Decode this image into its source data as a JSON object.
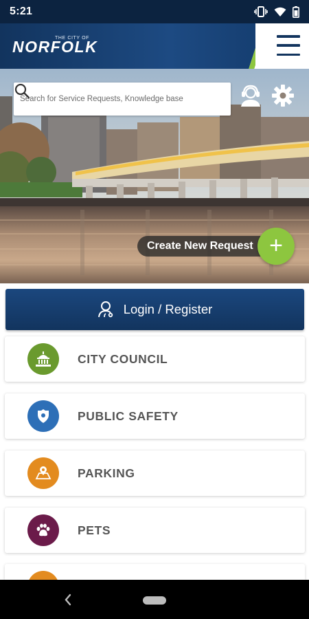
{
  "status_bar": {
    "time": "5:21",
    "icons": [
      "vibrate-icon",
      "wifi-icon",
      "battery-icon"
    ]
  },
  "header": {
    "logo_small": "THE CITY OF",
    "logo_main": "NORFOLK",
    "menu_icon": "hamburger-menu-icon",
    "colors": {
      "navy": "#12345e",
      "accent_green": "#8dc63f"
    }
  },
  "hero": {
    "search_placeholder": "Search for Service Requests, Knowledge base",
    "search_icon": "search-icon",
    "agent_icon": "agent-headset-icon",
    "settings_icon": "gear-icon",
    "create_request_label": "Create New Request",
    "create_request_icon": "+"
  },
  "login": {
    "label": "Login / Register",
    "icon": "user-login-icon"
  },
  "categories": [
    {
      "label": "CITY COUNCIL",
      "icon": "city-hall-icon",
      "color": "#6a9a2e"
    },
    {
      "label": "PUBLIC SAFETY",
      "icon": "police-badge-icon",
      "color": "#2d6fb7"
    },
    {
      "label": "PARKING",
      "icon": "parking-map-icon",
      "color": "#e38b1f"
    },
    {
      "label": "PETS",
      "icon": "paw-icon",
      "color": "#6b1b4a"
    }
  ],
  "partial_category": {
    "icon": "partial-category-icon",
    "color": "#e38b1f"
  },
  "nav_bar": {
    "back_icon": "back-icon",
    "home_icon": "home-pill-icon"
  }
}
